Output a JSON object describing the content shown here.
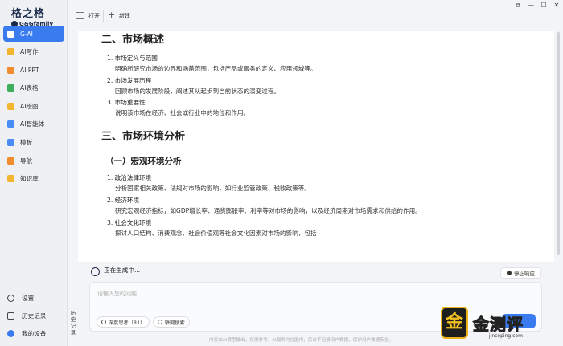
{
  "app": {
    "logo_cn": "格之格",
    "logo_en": "G&Gfamily"
  },
  "sidebar": {
    "items": [
      {
        "label": "G-AI",
        "icon": "g-ai-icon",
        "color": "#ffffff",
        "active": true
      },
      {
        "label": "AI写作",
        "icon": "write-icon",
        "color": "#f2b632"
      },
      {
        "label": "AI PPT",
        "icon": "ppt-icon",
        "color": "#f08c2e"
      },
      {
        "label": "AI表格",
        "icon": "table-icon",
        "color": "#3cae5c"
      },
      {
        "label": "AI绘图",
        "icon": "paint-icon",
        "color": "#f2b632"
      },
      {
        "label": "AI智能体",
        "icon": "agent-icon",
        "color": "#4a8cf5"
      },
      {
        "label": "模板",
        "icon": "template-icon",
        "color": "#4a8cf5"
      },
      {
        "label": "导航",
        "icon": "nav-icon",
        "color": "#f08c2e"
      },
      {
        "label": "知识库",
        "icon": "knowledge-icon",
        "color": "#f2b632"
      }
    ],
    "bottom": [
      {
        "label": "设置",
        "icon": "settings-icon"
      },
      {
        "label": "历史记录",
        "icon": "history-icon"
      },
      {
        "label": "我的设备",
        "icon": "device-icon"
      }
    ],
    "history_vertical": [
      "历",
      "史",
      "记",
      "录"
    ]
  },
  "topbar": {
    "open_label": "打开",
    "new_label": "新建",
    "win_controls": [
      "⧉",
      "—",
      "☐",
      "✕"
    ]
  },
  "document": {
    "section2": {
      "heading": "二、市场概述",
      "items": [
        {
          "title": "1. 市场定义与范围",
          "desc": "明确所研究市场的边界和涵盖范围，包括产品或服务的定义、应用领域等。"
        },
        {
          "title": "2. 市场发展历程",
          "desc": "回顾市场的发展阶段，阐述其从起步到当前状态的演变过程。"
        },
        {
          "title": "3. 市场重要性",
          "desc": "说明该市场在经济、社会或行业中的地位和作用。"
        }
      ]
    },
    "section3": {
      "heading": "三、市场环境分析",
      "subheading": "（一）宏观环境分析",
      "items": [
        {
          "title": "1. 政治法律环境",
          "desc": "分析国家相关政策、法规对市场的影响，如行业监管政策、税收政策等。"
        },
        {
          "title": "2. 经济环境",
          "desc": "研究宏观经济指标，如GDP增长率、通货膨胀率、利率等对市场的影响，以及经济周期对市场需求和供给的作用。"
        },
        {
          "title": "3. 社会文化环境",
          "desc": "探讨人口结构、消费观念、社会价值观等社会文化因素对市场的影响，包括"
        }
      ]
    }
  },
  "status": {
    "generating": "正在生成中...",
    "stop_label": "停止响应"
  },
  "input": {
    "placeholder": "请输入您的问题",
    "deep_think": "深度思考（R1）",
    "web_search": "联网搜索"
  },
  "footer": {
    "note": "内容由AI模型输出，仅供参考，AI服务均在国内，后台不记录用户数据，保护用户数据安全。"
  },
  "watermark": {
    "badge": "金",
    "text": "金测评",
    "sub": "jinceping.com"
  },
  "colors": {
    "accent": "#3a7bf0",
    "sidebar_bg": "#eef0f4"
  }
}
